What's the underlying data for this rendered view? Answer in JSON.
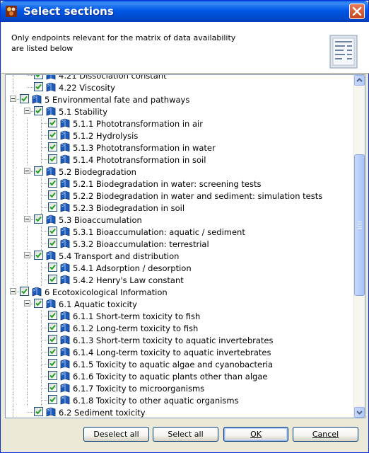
{
  "window": {
    "title": "Select sections"
  },
  "header": {
    "description_line1": "Only endpoints relevant for the matrix of data availability",
    "description_line2": "are listed below"
  },
  "tree": {
    "rows": [
      {
        "level": 2,
        "label": "4.21 Dissociation constant",
        "checked": true,
        "expander": false
      },
      {
        "level": 2,
        "label": "4.22 Viscosity",
        "checked": true,
        "expander": false
      },
      {
        "level": 1,
        "label": "5 Environmental fate and pathways",
        "checked": true,
        "expander": true
      },
      {
        "level": 2,
        "label": "5.1 Stability",
        "checked": true,
        "expander": true
      },
      {
        "level": 3,
        "label": "5.1.1 Phototransformation in air",
        "checked": true,
        "expander": false
      },
      {
        "level": 3,
        "label": "5.1.2 Hydrolysis",
        "checked": true,
        "expander": false
      },
      {
        "level": 3,
        "label": "5.1.3 Phototransformation in water",
        "checked": true,
        "expander": false
      },
      {
        "level": 3,
        "label": "5.1.4 Phototransformation in soil",
        "checked": true,
        "expander": false
      },
      {
        "level": 2,
        "label": "5.2 Biodegradation",
        "checked": true,
        "expander": true
      },
      {
        "level": 3,
        "label": "5.2.1 Biodegradation in water: screening tests",
        "checked": true,
        "expander": false
      },
      {
        "level": 3,
        "label": "5.2.2 Biodegradation in water and sediment: simulation tests",
        "checked": true,
        "expander": false
      },
      {
        "level": 3,
        "label": "5.2.3 Biodegradation in soil",
        "checked": true,
        "expander": false
      },
      {
        "level": 2,
        "label": "5.3 Bioaccumulation",
        "checked": true,
        "expander": true
      },
      {
        "level": 3,
        "label": "5.3.1 Bioaccumulation: aquatic / sediment",
        "checked": true,
        "expander": false
      },
      {
        "level": 3,
        "label": "5.3.2 Bioaccumulation: terrestrial",
        "checked": true,
        "expander": false
      },
      {
        "level": 2,
        "label": "5.4 Transport and distribution",
        "checked": true,
        "expander": true
      },
      {
        "level": 3,
        "label": "5.4.1 Adsorption / desorption",
        "checked": true,
        "expander": false
      },
      {
        "level": 3,
        "label": "5.4.2 Henry's Law constant",
        "checked": true,
        "expander": false
      },
      {
        "level": 1,
        "label": "6 Ecotoxicological Information",
        "checked": true,
        "expander": true
      },
      {
        "level": 2,
        "label": "6.1 Aquatic toxicity",
        "checked": true,
        "expander": true
      },
      {
        "level": 3,
        "label": "6.1.1 Short-term toxicity to fish",
        "checked": true,
        "expander": false
      },
      {
        "level": 3,
        "label": "6.1.2 Long-term toxicity to fish",
        "checked": true,
        "expander": false
      },
      {
        "level": 3,
        "label": "6.1.3 Short-term toxicity to aquatic invertebrates",
        "checked": true,
        "expander": false
      },
      {
        "level": 3,
        "label": "6.1.4 Long-term toxicity to aquatic invertebrates",
        "checked": true,
        "expander": false
      },
      {
        "level": 3,
        "label": "6.1.5 Toxicity to aquatic algae and cyanobacteria",
        "checked": true,
        "expander": false
      },
      {
        "level": 3,
        "label": "6.1.6 Toxicity to aquatic plants other than algae",
        "checked": true,
        "expander": false
      },
      {
        "level": 3,
        "label": "6.1.7 Toxicity to microorganisms",
        "checked": true,
        "expander": false
      },
      {
        "level": 3,
        "label": "6.1.8 Toxicity to other aquatic organisms",
        "checked": true,
        "expander": false
      },
      {
        "level": 2,
        "label": "6.2 Sediment toxicity",
        "checked": true,
        "expander": false
      }
    ]
  },
  "buttons": {
    "deselect_all": "Deselect all",
    "select_all": "Select all",
    "ok": "OK",
    "cancel": "Cancel"
  },
  "colors": {
    "titlebar": "#0058e6",
    "checkmark": "#21a121",
    "book": "#1e5bb8"
  },
  "icons": {
    "app": "app-icon",
    "close": "close-icon",
    "header": "document-list-icon",
    "node": "book-icon",
    "check": "checkmark-icon"
  }
}
